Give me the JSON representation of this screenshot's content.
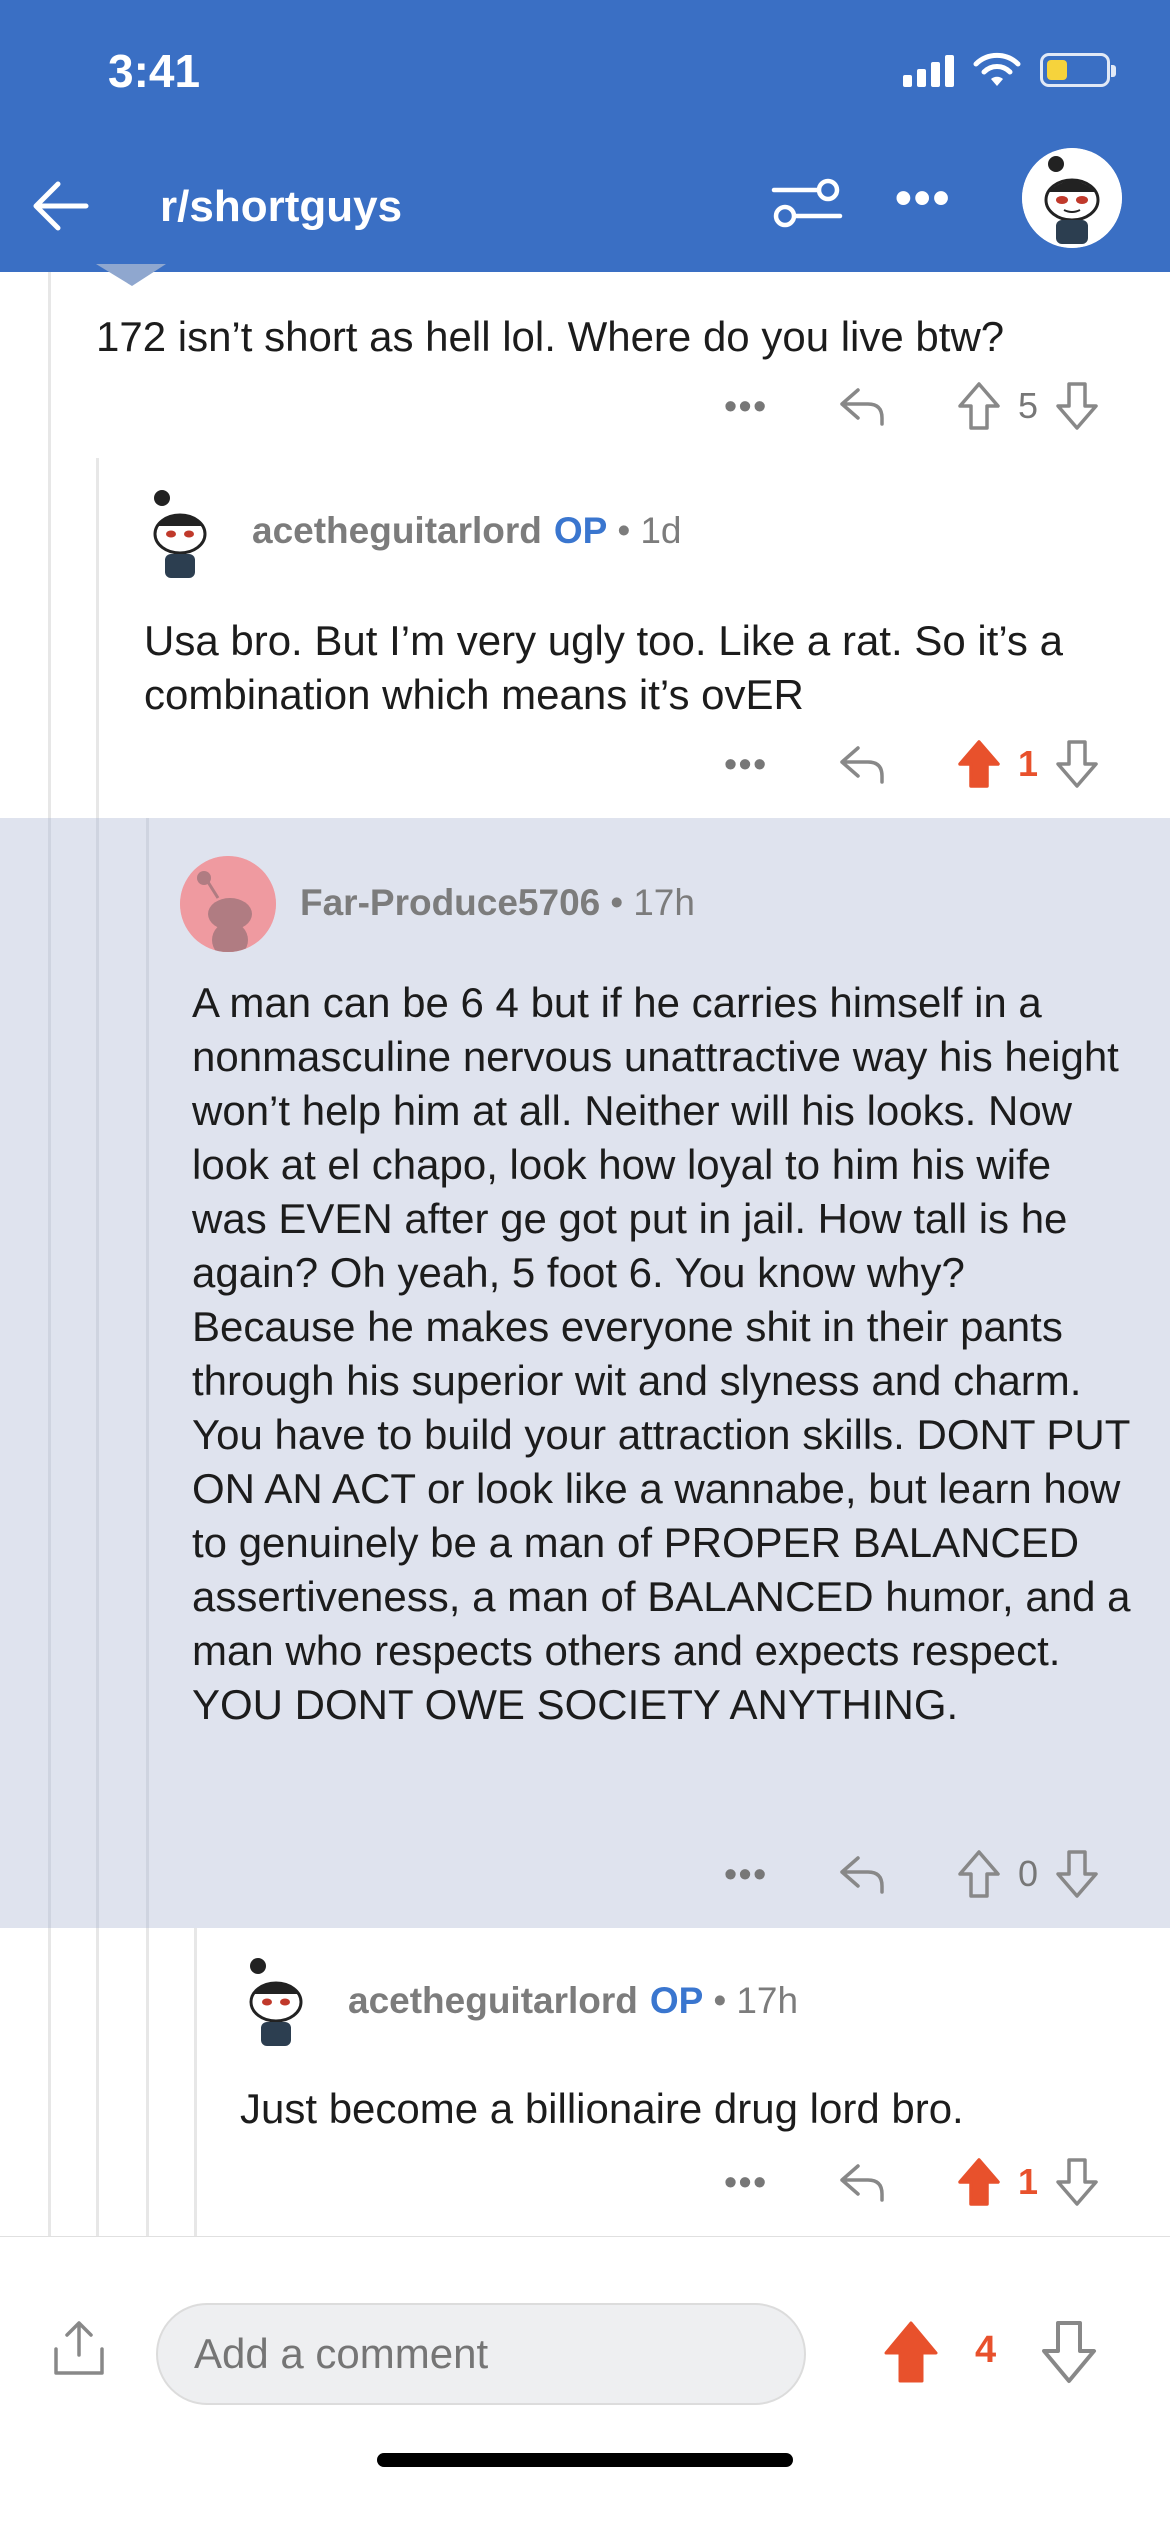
{
  "status_bar": {
    "time": "3:41"
  },
  "header": {
    "subreddit": "r/shortguys"
  },
  "comments": [
    {
      "text": "172 isn’t short as hell lol. Where do you live btw?",
      "score": "5",
      "voted": false
    },
    {
      "author": "acetheguitarlord",
      "op_badge": "OP",
      "age": "1d",
      "text": "Usa bro. But I’m very ugly too. Like a rat. So it’s a combination which means it’s ovER",
      "score": "1",
      "voted": true
    },
    {
      "author": "Far-Produce5706",
      "age": "17h",
      "text": "A man can be 6 4 but if he carries himself in a nonmasculine nervous unattractive way his height won’t help him at all. Neither will his looks. Now look at el chapo, look how loyal to him his wife was EVEN after ge got put in jail. How tall is he again? Oh yeah, 5 foot 6. You know why? Because he makes everyone shit in their pants through his superior wit and slyness and charm. You have to build your attraction skills. DONT PUT ON AN ACT or look like a wannabe, but learn how to genuinely be a man of PROPER BALANCED assertiveness, a man of BALANCED humor, and a man who respects others and expects respect. YOU DONT OWE SOCIETY ANYTHING.",
      "score": "0",
      "voted": false
    },
    {
      "author": "acetheguitarlord",
      "op_badge": "OP",
      "age": "17h",
      "text": "Just become a billionaire drug lord bro.",
      "score": "1",
      "voted": true
    }
  ],
  "actions": {
    "more": "•••",
    "separator": "•"
  },
  "bottom_bar": {
    "comment_placeholder": "Add a comment",
    "post_score": "4"
  },
  "colors": {
    "header_bg": "#3a6fc4",
    "upvote_active": "#e8512c",
    "op_badge": "#3a76cf",
    "highlight_bg": "#dfe3ee"
  },
  "icons": [
    "back-arrow-icon",
    "filter-icon",
    "more-icon",
    "reply-icon",
    "upvote-icon",
    "downvote-icon",
    "share-icon"
  ]
}
